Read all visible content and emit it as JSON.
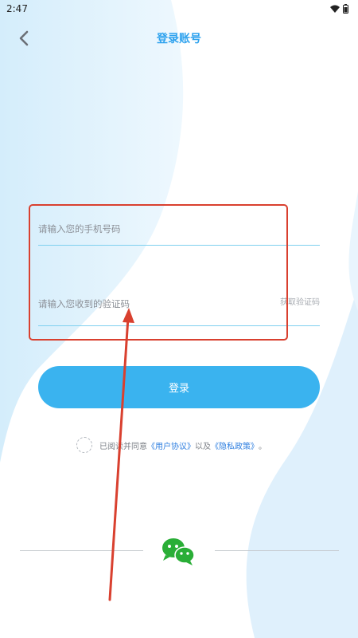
{
  "status_bar": {
    "time": "2:47"
  },
  "nav": {
    "title": "登录账号"
  },
  "form": {
    "phone_placeholder": "请输入您的手机号码",
    "code_placeholder": "请输入您收到的验证码",
    "get_code_label": "获取验证码"
  },
  "login_button": {
    "label": "登录"
  },
  "agreement": {
    "prefix": "已阅读并同意",
    "user_agreement": "《用户协议》",
    "joiner": "以及",
    "privacy_policy": "《隐私政策》",
    "suffix": "。"
  },
  "colors": {
    "accent": "#2ea2ee",
    "button": "#3ab3ef",
    "annotation": "#d9402f",
    "wechat": "#2aae37"
  },
  "icons": [
    "back-chevron-icon",
    "wifi-icon",
    "battery-icon",
    "wechat-icon",
    "checkbox-circle-icon"
  ]
}
